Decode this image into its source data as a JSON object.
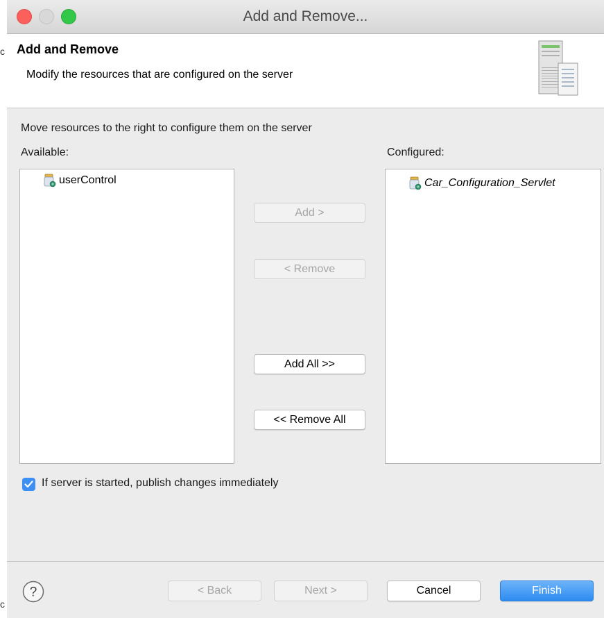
{
  "window": {
    "title": "Add and Remove..."
  },
  "header": {
    "title": "Add and Remove",
    "description": "Modify the resources that are configured on the server"
  },
  "main": {
    "instruction": "Move resources to the right to configure them on the server",
    "available_label": "Available:",
    "configured_label": "Configured:",
    "available_items": [
      "userControl"
    ],
    "configured_items": [
      "Car_Configuration_Servlet"
    ],
    "buttons": {
      "add": "Add >",
      "remove": "< Remove",
      "add_all": "Add All >>",
      "remove_all": "<< Remove All"
    },
    "publish_checkbox": {
      "label": "If server is started, publish changes immediately",
      "checked": true
    }
  },
  "footer": {
    "back": "< Back",
    "next": "Next >",
    "cancel": "Cancel",
    "finish": "Finish"
  },
  "colors": {
    "accent": "#3d8ff5",
    "close": "#fc605c",
    "maximize": "#34c84a"
  },
  "icons": [
    "jar-icon",
    "server-icon",
    "help-icon",
    "checkmark-icon"
  ]
}
